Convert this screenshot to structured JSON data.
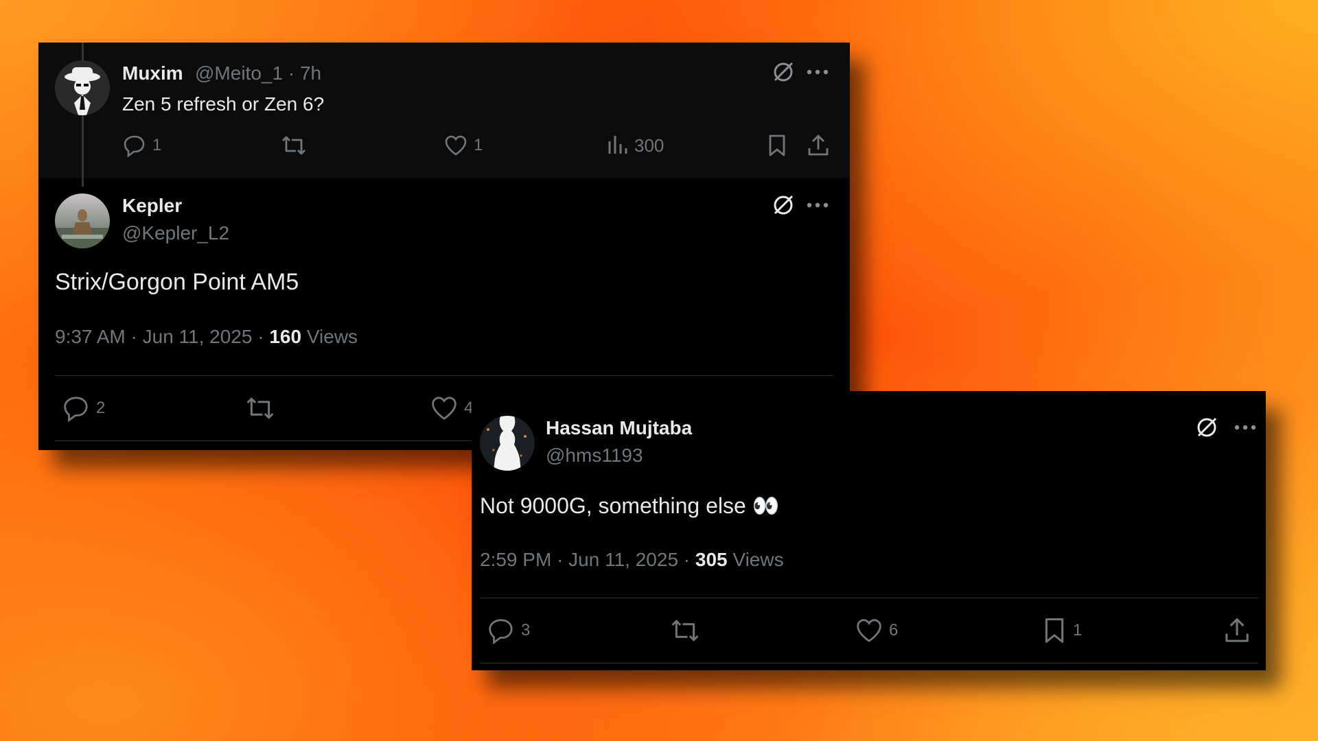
{
  "parent_tweet": {
    "name": "Muxim",
    "handle": "@Meito_1",
    "time": "7h",
    "text": "Zen 5 refresh or Zen 6?",
    "replies": "1",
    "likes": "1",
    "views": "300"
  },
  "main_tweet": {
    "name": "Kepler",
    "handle": "@Kepler_L2",
    "text": "Strix/Gorgon Point AM5",
    "time": "9:37 AM",
    "date": "Jun 11, 2025",
    "views_count": "160",
    "views_label": "Views",
    "replies": "2",
    "likes": "4"
  },
  "reply_tweet": {
    "name": "Hassan Mujtaba",
    "handle": "@hms1193",
    "text": "Not 9000G, something else 👀",
    "time": "2:59 PM",
    "date": "Jun 11, 2025",
    "views_count": "305",
    "views_label": "Views",
    "replies": "3",
    "likes": "6",
    "bookmarks": "1"
  },
  "separator": "·",
  "icons": [
    "grok-icon",
    "more-icon",
    "reply-icon",
    "retweet-icon",
    "like-icon",
    "views-icon",
    "bookmark-icon",
    "share-icon"
  ]
}
